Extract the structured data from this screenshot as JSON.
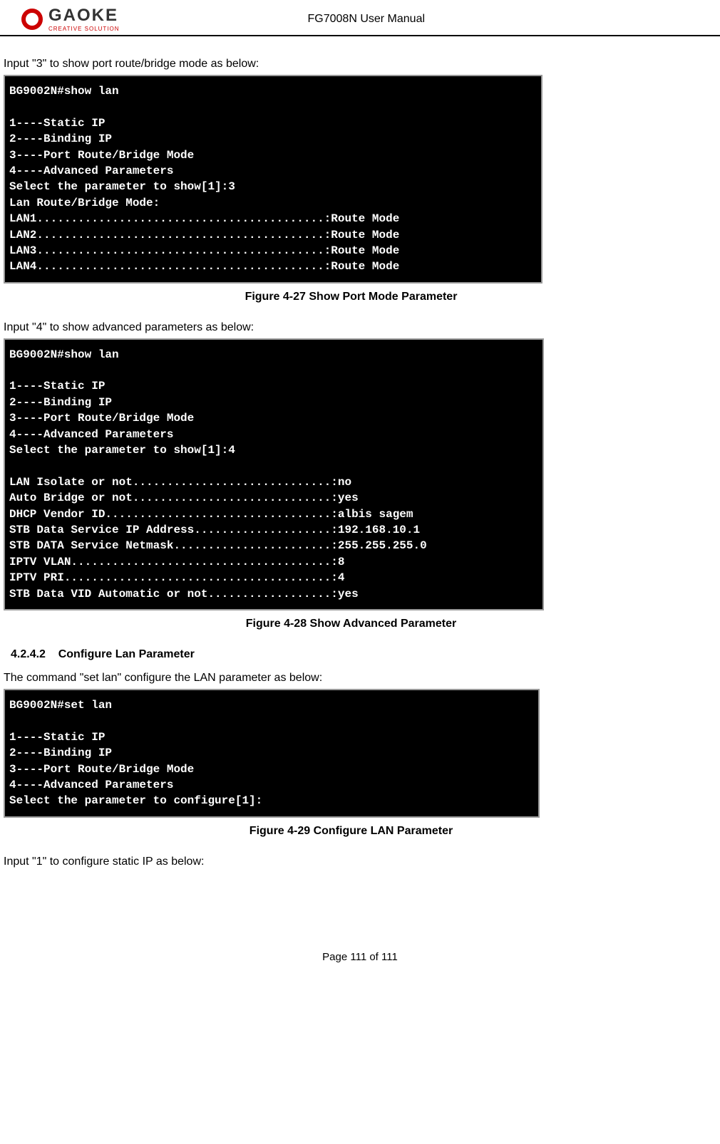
{
  "header": {
    "logo_text": "GAOKE",
    "logo_sub": "CREATIVE SOLUTION",
    "doc_title": "FG7008N User Manual"
  },
  "body": {
    "intro_3": "Input \"3\" to show port route/bridge mode as below:",
    "terminal_1": "BG9002N#show lan\n\n1----Static IP\n2----Binding IP\n3----Port Route/Bridge Mode\n4----Advanced Parameters\nSelect the parameter to show[1]:3\nLan Route/Bridge Mode:\nLAN1..........................................:Route Mode\nLAN2..........................................:Route Mode\nLAN3..........................................:Route Mode\nLAN4..........................................:Route Mode",
    "caption_1": "Figure 4-27  Show Port Mode Parameter",
    "intro_4": "Input \"4\" to show advanced parameters as below:",
    "terminal_2": "BG9002N#show lan\n\n1----Static IP\n2----Binding IP\n3----Port Route/Bridge Mode\n4----Advanced Parameters\nSelect the parameter to show[1]:4\n\nLAN Isolate or not.............................:no\nAuto Bridge or not.............................:yes\nDHCP Vendor ID.................................:albis sagem\nSTB Data Service IP Address....................:192.168.10.1\nSTB DATA Service Netmask.......................:255.255.255.0\nIPTV VLAN......................................:8\nIPTV PRI.......................................:4\nSTB Data VID Automatic or not..................:yes",
    "caption_2": "Figure 4-28  Show Advanced Parameter",
    "section_number": "4.2.4.2",
    "section_title": "Configure Lan Parameter",
    "set_lan_intro": "The command \"set lan\" configure the LAN parameter as below:",
    "terminal_3": "BG9002N#set lan\n\n1----Static IP\n2----Binding IP\n3----Port Route/Bridge Mode\n4----Advanced Parameters\nSelect the parameter to configure[1]:",
    "caption_3": "Figure 4-29  Configure LAN Parameter",
    "intro_1": "Input \"1\" to configure static IP as below:"
  },
  "footer": {
    "page_label": "Page 111 of 111"
  }
}
